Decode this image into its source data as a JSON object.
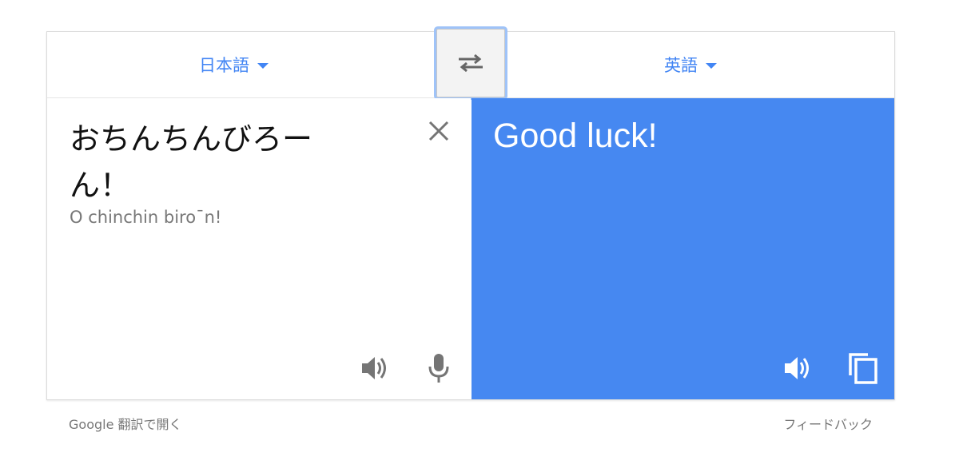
{
  "languages": {
    "source": "日本語",
    "target": "英語"
  },
  "source": {
    "text": "おちんちんびろーん！",
    "romanization": "O chinchin biro¯n!"
  },
  "target": {
    "translation": "Good luck!"
  },
  "footer": {
    "open_in_translate": "Google 翻訳で開く",
    "feedback": "フィードバック"
  },
  "colors": {
    "accent": "#4285f4",
    "target_background": "#4688f1",
    "icon_gray": "#757575"
  },
  "icons": {
    "swap": "swap-arrows-icon",
    "clear": "close-icon",
    "speaker": "speaker-icon",
    "mic": "microphone-icon",
    "copy": "copy-icon"
  }
}
